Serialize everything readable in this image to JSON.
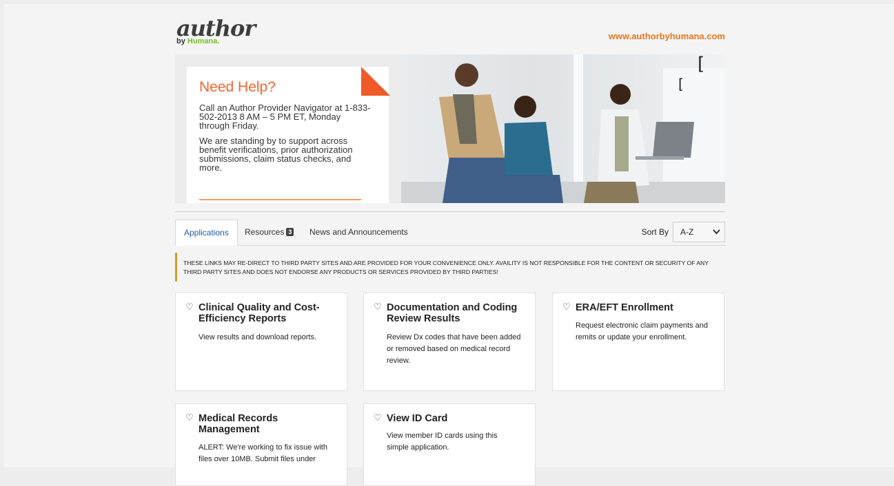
{
  "header": {
    "logo_word": "author",
    "logo_by": "by",
    "logo_brand": "Humana.",
    "site_link": "www.authorbyhumana.com"
  },
  "hero": {
    "help_title": "Need Help?",
    "help_paragraph_1": "Call an Author Provider Navigator at 1-833-502-2013 8 AM – 5 PM ET, Monday through Friday.",
    "help_paragraph_2": "We are standing by to support across benefit verifications, prior authorization submissions, claim status checks, and more."
  },
  "tabs": [
    {
      "label": "Applications",
      "active": true
    },
    {
      "label": "Resources",
      "badge": "3"
    },
    {
      "label": "News and Announcements"
    }
  ],
  "sort": {
    "label": "Sort By",
    "value": "A-Z"
  },
  "notice": "THESE LINKS MAY RE-DIRECT TO THIRD PARTY SITES AND ARE PROVIDED FOR YOUR CONVENIENCE ONLY. AVAILITY IS NOT RESPONSIBLE FOR THE CONTENT OR SECURITY OF ANY THIRD PARTY SITES AND DOES NOT ENDORSE ANY PRODUCTS OR SERVICES PROVIDED BY THIRD PARTIES!",
  "cards": [
    {
      "title": "Clinical Quality and Cost-Efficiency Reports",
      "desc": "View results and download reports."
    },
    {
      "title": "Documentation and Coding Review Results",
      "desc": "Review Dx codes that have been added or removed based on medical record review."
    },
    {
      "title": "ERA/EFT Enrollment",
      "desc": "Request electronic claim payments and remits or update your enrollment."
    },
    {
      "title": "Medical Records Management",
      "desc": "ALERT: We're working to fix issue with files over 10MB. Submit files under"
    },
    {
      "title": "View ID Card",
      "desc": "View member ID cards using this simple application."
    }
  ],
  "colors": {
    "accent_orange": "#e87722",
    "brand_green": "#78be20",
    "tab_blue": "#1f5aa6",
    "notice_bar": "#c9a227"
  }
}
